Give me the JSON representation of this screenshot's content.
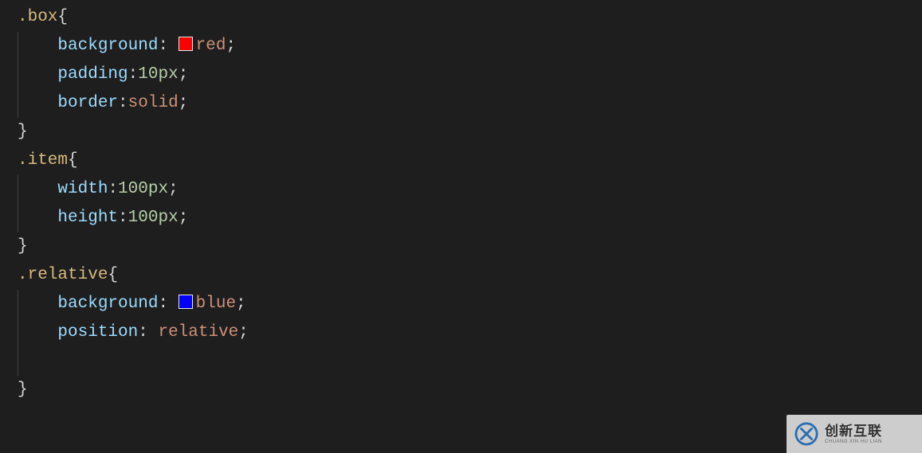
{
  "code": {
    "rules": [
      {
        "selector": ".box",
        "decls": [
          {
            "prop": "background",
            "swatch": "#ff0000",
            "value": "red",
            "colonSpace": " "
          },
          {
            "prop": "padding",
            "number": "10",
            "unit": "px",
            "colonSpace": ""
          },
          {
            "prop": "border",
            "value": "solid",
            "colonSpace": ""
          }
        ]
      },
      {
        "selector": ".item",
        "decls": [
          {
            "prop": "width",
            "number": "100",
            "unit": "px",
            "colonSpace": ""
          },
          {
            "prop": "height",
            "number": "100",
            "unit": "px",
            "colonSpace": ""
          }
        ]
      },
      {
        "selector": ".relative",
        "decls": [
          {
            "prop": "background",
            "swatch": "#0000ff",
            "value": "blue",
            "colonSpace": " "
          },
          {
            "prop": "position",
            "value": "relative",
            "colonSpace": " "
          }
        ],
        "blankLineBeforeClose": true
      }
    ],
    "indent": "    "
  },
  "watermark": {
    "main": "创新互联",
    "sub": "CHUANG XIN HU LIAN"
  }
}
